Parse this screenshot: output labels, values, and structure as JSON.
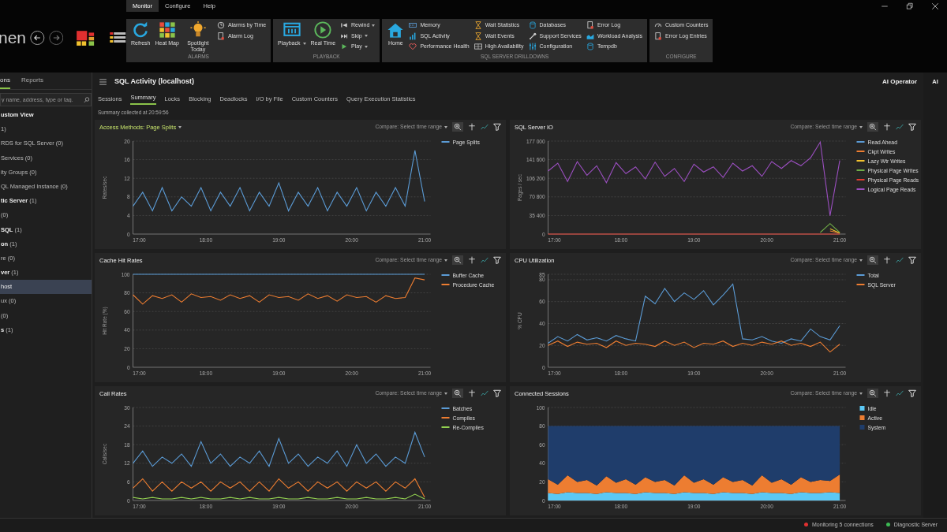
{
  "brand": "nen",
  "menu_tabs": [
    {
      "label": "Monitor",
      "selected": true
    },
    {
      "label": "Configure",
      "selected": false
    },
    {
      "label": "Help",
      "selected": false
    }
  ],
  "ribbon": [
    {
      "caption": "ALARMS",
      "items": [
        {
          "label": "Refresh",
          "kind": "large"
        },
        {
          "label": "Heat Map",
          "kind": "large"
        },
        {
          "label": "Spotlight Today",
          "kind": "large"
        },
        {
          "label": "Alarms by Time",
          "kind": "small"
        },
        {
          "label": "Alarm Log",
          "kind": "small"
        }
      ]
    },
    {
      "caption": "PLAYBACK",
      "items": [
        {
          "label": "Playback",
          "kind": "large",
          "dropdown": true
        },
        {
          "label": "Real Time",
          "kind": "large"
        },
        {
          "label": "Rewind",
          "kind": "small",
          "dropdown": true
        },
        {
          "label": "Skip",
          "kind": "small",
          "dropdown": true
        },
        {
          "label": "Play",
          "kind": "small",
          "dropdown": true
        }
      ]
    },
    {
      "caption": "SQL SERVER DRILLDOWNS",
      "items": [
        {
          "label": "Home",
          "kind": "large"
        },
        {
          "label": "Memory",
          "kind": "small"
        },
        {
          "label": "SQL Activity",
          "kind": "small"
        },
        {
          "label": "Performance Health",
          "kind": "small"
        },
        {
          "label": "Wait Statistics",
          "kind": "small"
        },
        {
          "label": "Wait Events",
          "kind": "small"
        },
        {
          "label": "High Availability",
          "kind": "small"
        },
        {
          "label": "Databases",
          "kind": "small"
        },
        {
          "label": "Support Services",
          "kind": "small"
        },
        {
          "label": "Configuration",
          "kind": "small"
        },
        {
          "label": "Error Log",
          "kind": "small"
        },
        {
          "label": "Workload Analysis",
          "kind": "small"
        },
        {
          "label": "Tempdb",
          "kind": "small"
        }
      ]
    },
    {
      "caption": "CONFIGURE",
      "items": [
        {
          "label": "Custom Counters",
          "kind": "small"
        },
        {
          "label": "Error Log Entries",
          "kind": "small"
        }
      ]
    }
  ],
  "sidebar": {
    "tabs": [
      {
        "label": "ons",
        "selected": true
      },
      {
        "label": "Reports",
        "selected": false
      }
    ],
    "search": {
      "placeholder": "y name, address, type or tag."
    },
    "items": [
      {
        "text": "**ustom View**",
        "selected": false
      },
      {
        "text": "1)",
        "selected": false
      },
      {
        "text": "RDS for SQL Server (0)",
        "selected": false
      },
      {
        "text": "Services (0)",
        "selected": false
      },
      {
        "text": "ity Groups (0)",
        "selected": false
      },
      {
        "text": "QL Managed Instance (0)",
        "selected": false
      },
      {
        "text": "**tic Server** (1)",
        "selected": false
      },
      {
        "text": "(0)",
        "selected": false
      },
      {
        "text": "**SQL** (1)",
        "selected": false
      },
      {
        "text": "**on** (1)",
        "selected": false
      },
      {
        "text": "re (0)",
        "selected": false
      },
      {
        "text": "**ver** (1)",
        "selected": false
      },
      {
        "text": "host",
        "selected": true
      },
      {
        "text": "ux (0)",
        "selected": false
      },
      {
        "text": "(0)",
        "selected": false
      },
      {
        "text": "**s** (1)",
        "selected": false
      }
    ]
  },
  "main": {
    "title": "SQL Activity (localhost)",
    "ai_operator": "AI Operator",
    "tabs": [
      {
        "label": "Sessions",
        "selected": false
      },
      {
        "label": "Summary",
        "selected": true
      },
      {
        "label": "Locks",
        "selected": false
      },
      {
        "label": "Blocking",
        "selected": false
      },
      {
        "label": "Deadlocks",
        "selected": false
      },
      {
        "label": "I/O by File",
        "selected": false
      },
      {
        "label": "Custom Counters",
        "selected": false
      },
      {
        "label": "Query Execution Statistics",
        "selected": false
      }
    ],
    "collected": "Summary collected at 20:59:56",
    "panels": [
      {
        "title": "Access Methods: Page Splits",
        "title_dropdown": true,
        "compare": "Compare: Select time range",
        "chart_data": {
          "type": "line",
          "grid": true,
          "legend": "right",
          "ylabel": "Rates/sec",
          "x": [
            17,
            17.133,
            17.267,
            17.4,
            17.533,
            17.667,
            17.8,
            17.933,
            18.067,
            18.2,
            18.333,
            18.467,
            18.6,
            18.733,
            18.867,
            19,
            19.133,
            19.267,
            19.4,
            19.533,
            19.667,
            19.8,
            19.933,
            20.067,
            20.2,
            20.333,
            20.467,
            20.6,
            20.733,
            20.867,
            21
          ],
          "xlim": [
            17,
            21.08
          ],
          "ylim": [
            0,
            20
          ],
          "xticks": [
            {
              "value": 17,
              "label": "17:00"
            },
            {
              "value": 18,
              "label": "18:00"
            },
            {
              "value": 19,
              "label": "19:00"
            },
            {
              "value": 20,
              "label": "20:00"
            },
            {
              "value": 21,
              "label": "21:00"
            }
          ],
          "yticks": [
            0,
            4,
            8,
            12,
            16,
            20
          ],
          "series": [
            {
              "name": "Page Splits",
              "color": "#5b9bd5",
              "values": [
                6,
                9,
                5,
                10,
                5,
                8,
                6,
                10,
                5,
                9,
                6,
                10,
                5,
                9,
                6,
                11,
                5,
                9,
                6,
                10,
                5,
                9,
                6,
                10,
                5,
                9,
                6,
                10,
                6,
                18,
                7
              ]
            }
          ]
        }
      },
      {
        "title": "SQL Server IO",
        "title_dropdown": false,
        "compare": "Compare: Select time range",
        "chart_data": {
          "type": "line",
          "grid": true,
          "legend": "right",
          "ylabel": "Pages / sec",
          "x": [
            17,
            17.133,
            17.267,
            17.4,
            17.533,
            17.667,
            17.8,
            17.933,
            18.067,
            18.2,
            18.333,
            18.467,
            18.6,
            18.733,
            18.867,
            19,
            19.133,
            19.267,
            19.4,
            19.533,
            19.667,
            19.8,
            19.933,
            20.067,
            20.2,
            20.333,
            20.467,
            20.6,
            20.733,
            20.867,
            21
          ],
          "xlim": [
            17,
            21.08
          ],
          "ylim": [
            0,
            177000
          ],
          "xticks": [
            {
              "value": 17,
              "label": "17:00"
            },
            {
              "value": 18,
              "label": "18:00"
            },
            {
              "value": 19,
              "label": "19:00"
            },
            {
              "value": 20,
              "label": "20:00"
            },
            {
              "value": 21,
              "label": "21:00"
            }
          ],
          "yticks": [
            {
              "value": 0,
              "label": "0"
            },
            {
              "value": 35400,
              "label": "35 400"
            },
            {
              "value": 70800,
              "label": "70 800"
            },
            {
              "value": 106200,
              "label": "106 200"
            },
            {
              "value": 141600,
              "label": "141 600"
            },
            {
              "value": 177000,
              "label": "177 000"
            }
          ],
          "series": [
            {
              "name": "Read Ahead",
              "color": "#5b9bd5",
              "values": [
                null,
                null,
                null,
                null,
                null,
                null,
                null,
                null,
                null,
                null,
                null,
                null,
                null,
                null,
                null,
                null,
                null,
                null,
                null,
                null,
                null,
                null,
                null,
                null,
                null,
                null,
                null,
                null,
                null,
                null,
                null
              ]
            },
            {
              "name": "Ckpt Writes",
              "color": "#ed7d31",
              "values": [
                null,
                null,
                null,
                null,
                null,
                null,
                null,
                null,
                null,
                null,
                null,
                null,
                null,
                null,
                null,
                null,
                null,
                null,
                null,
                null,
                null,
                null,
                null,
                null,
                null,
                null,
                null,
                null,
                null,
                6000,
                2000
              ]
            },
            {
              "name": "Lazy Wtr Writes",
              "color": "#f2c12e",
              "values": [
                null,
                null,
                null,
                null,
                null,
                null,
                null,
                null,
                null,
                null,
                null,
                null,
                null,
                null,
                null,
                null,
                null,
                null,
                null,
                null,
                null,
                null,
                null,
                null,
                null,
                null,
                null,
                null,
                null,
                10000,
                2000
              ]
            },
            {
              "name": "Physical Page Writes",
              "color": "#70ad47",
              "values": [
                null,
                null,
                null,
                null,
                null,
                null,
                null,
                null,
                null,
                null,
                null,
                null,
                null,
                null,
                null,
                null,
                null,
                null,
                null,
                null,
                null,
                null,
                null,
                null,
                null,
                null,
                null,
                null,
                3000,
                20000,
                3000
              ]
            },
            {
              "name": "Physical Page Reads",
              "color": "#e03c31",
              "values": [
                0,
                0,
                0,
                0,
                0,
                0,
                0,
                0,
                0,
                0,
                0,
                0,
                0,
                0,
                0,
                0,
                0,
                0,
                0,
                0,
                0,
                0,
                0,
                0,
                0,
                0,
                0,
                0,
                0,
                0,
                0
              ]
            },
            {
              "name": "Logical Page Reads",
              "color": "#9b4fc0",
              "values": [
                120000,
                135000,
                100000,
                138000,
                112000,
                130000,
                98000,
                136000,
                115000,
                128000,
                105000,
                137000,
                110000,
                125000,
                100000,
                133000,
                118000,
                128000,
                108000,
                135000,
                120000,
                130000,
                110000,
                138000,
                125000,
                140000,
                130000,
                145000,
                175000,
                35000,
                140000
              ]
            }
          ]
        }
      },
      {
        "title": "Cache Hit Rates",
        "title_dropdown": false,
        "compare": "Compare: Select time range",
        "chart_data": {
          "type": "line",
          "grid": true,
          "legend": "right",
          "ylabel": "Hit Rate (%)",
          "x": [
            17,
            17.133,
            17.267,
            17.4,
            17.533,
            17.667,
            17.8,
            17.933,
            18.067,
            18.2,
            18.333,
            18.467,
            18.6,
            18.733,
            18.867,
            19,
            19.133,
            19.267,
            19.4,
            19.533,
            19.667,
            19.8,
            19.933,
            20.067,
            20.2,
            20.333,
            20.467,
            20.6,
            20.733,
            20.867,
            21
          ],
          "xlim": [
            17,
            21.08
          ],
          "ylim": [
            0,
            100
          ],
          "xticks": [
            {
              "value": 17,
              "label": "17:00"
            },
            {
              "value": 18,
              "label": "18:00"
            },
            {
              "value": 19,
              "label": "19:00"
            },
            {
              "value": 20,
              "label": "20:00"
            },
            {
              "value": 21,
              "label": "21:00"
            }
          ],
          "yticks": [
            0,
            20,
            40,
            60,
            80,
            100
          ],
          "series": [
            {
              "name": "Buffer Cache",
              "color": "#5b9bd5",
              "values": [
                100,
                100,
                100,
                100,
                100,
                100,
                100,
                100,
                100,
                100,
                100,
                100,
                100,
                100,
                100,
                100,
                100,
                100,
                100,
                100,
                100,
                100,
                100,
                100,
                100,
                100,
                100,
                100,
                100,
                100,
                100
              ]
            },
            {
              "name": "Procedure Cache",
              "color": "#ed7d31",
              "values": [
                78,
                68,
                77,
                74,
                78,
                70,
                79,
                75,
                76,
                72,
                78,
                74,
                77,
                70,
                78,
                75,
                76,
                72,
                79,
                74,
                77,
                71,
                78,
                75,
                76,
                70,
                77,
                74,
                75,
                96,
                94
              ]
            }
          ]
        }
      },
      {
        "title": "CPU Utilization",
        "title_dropdown": false,
        "compare": "Compare: Select time range",
        "chart_data": {
          "type": "line",
          "grid": true,
          "legend": "right",
          "ylabel": "% CPU",
          "x": [
            17,
            17.133,
            17.267,
            17.4,
            17.533,
            17.667,
            17.8,
            17.933,
            18.067,
            18.2,
            18.333,
            18.467,
            18.6,
            18.733,
            18.867,
            19,
            19.133,
            19.267,
            19.4,
            19.533,
            19.667,
            19.8,
            19.933,
            20.067,
            20.2,
            20.333,
            20.467,
            20.6,
            20.733,
            20.867,
            21
          ],
          "xlim": [
            17,
            21.08
          ],
          "ylim": [
            0,
            85
          ],
          "xticks": [
            {
              "value": 17,
              "label": "17:00"
            },
            {
              "value": 18,
              "label": "18:00"
            },
            {
              "value": 19,
              "label": "19:00"
            },
            {
              "value": 20,
              "label": "20:00"
            },
            {
              "value": 21,
              "label": "21:00"
            }
          ],
          "yticks": [
            0,
            20,
            40,
            60,
            80,
            85
          ],
          "series": [
            {
              "name": "Total",
              "color": "#5b9bd5",
              "values": [
                22,
                28,
                24,
                30,
                25,
                27,
                24,
                29,
                26,
                24,
                65,
                58,
                72,
                60,
                68,
                62,
                70,
                57,
                66,
                76,
                26,
                25,
                28,
                24,
                22,
                26,
                24,
                35,
                28,
                25,
                38
              ]
            },
            {
              "name": "SQL Server",
              "color": "#ed7d31",
              "values": [
                20,
                24,
                19,
                23,
                21,
                22,
                18,
                24,
                20,
                22,
                21,
                19,
                24,
                20,
                23,
                18,
                22,
                21,
                24,
                19,
                22,
                20,
                23,
                21,
                24,
                20,
                22,
                19,
                23,
                14,
                21
              ]
            }
          ]
        }
      },
      {
        "title": "Call Rates",
        "title_dropdown": false,
        "compare": "Compare: Select time range",
        "chart_data": {
          "type": "line",
          "grid": true,
          "legend": "right",
          "ylabel": "Calls/sec",
          "x": [
            17,
            17.133,
            17.267,
            17.4,
            17.533,
            17.667,
            17.8,
            17.933,
            18.067,
            18.2,
            18.333,
            18.467,
            18.6,
            18.733,
            18.867,
            19,
            19.133,
            19.267,
            19.4,
            19.533,
            19.667,
            19.8,
            19.933,
            20.067,
            20.2,
            20.333,
            20.467,
            20.6,
            20.733,
            20.867,
            21
          ],
          "xlim": [
            17,
            21.08
          ],
          "ylim": [
            0,
            30
          ],
          "xticks": [
            {
              "value": 17,
              "label": "17:00"
            },
            {
              "value": 18,
              "label": "18:00"
            },
            {
              "value": 19,
              "label": "19:00"
            },
            {
              "value": 20,
              "label": "20:00"
            },
            {
              "value": 21,
              "label": "21:00"
            }
          ],
          "yticks": [
            0,
            6,
            12,
            18,
            24,
            30
          ],
          "series": [
            {
              "name": "Batches",
              "color": "#5b9bd5",
              "values": [
                12,
                16,
                11,
                14,
                12,
                15,
                11,
                19,
                12,
                15,
                11,
                14,
                12,
                16,
                11,
                20,
                12,
                15,
                11,
                14,
                12,
                16,
                11,
                18,
                12,
                15,
                11,
                14,
                12,
                22,
                14
              ]
            },
            {
              "name": "Compiles",
              "color": "#ed7d31",
              "values": [
                4,
                7,
                3,
                6,
                3,
                6,
                4,
                6,
                3,
                6,
                4,
                6,
                3,
                6,
                3,
                7,
                4,
                6,
                3,
                6,
                4,
                6,
                3,
                6,
                4,
                6,
                3,
                6,
                4,
                7,
                1
              ]
            },
            {
              "name": "Re-Compiles",
              "color": "#92d050",
              "values": [
                1,
                0.5,
                1,
                0.5,
                0.5,
                1,
                0.5,
                1,
                0.5,
                0.5,
                1,
                0.5,
                1,
                0.5,
                0.5,
                1,
                0.5,
                0.5,
                1,
                0.5,
                0.5,
                1,
                0.5,
                0.5,
                1,
                0.5,
                0.5,
                1,
                0.5,
                2,
                0.5
              ]
            }
          ]
        }
      },
      {
        "title": "Connected Sessions",
        "title_dropdown": false,
        "compare": "Compare: Select time range",
        "chart_data": {
          "type": "area",
          "stacked": true,
          "grid": true,
          "legend": "right",
          "x": [
            17,
            17.133,
            17.267,
            17.4,
            17.533,
            17.667,
            17.8,
            17.933,
            18.067,
            18.2,
            18.333,
            18.467,
            18.6,
            18.733,
            18.867,
            19,
            19.133,
            19.267,
            19.4,
            19.533,
            19.667,
            19.8,
            19.933,
            20.067,
            20.2,
            20.333,
            20.467,
            20.6,
            20.733,
            20.867,
            21
          ],
          "xlim": [
            17,
            21.08
          ],
          "ylim": [
            0,
            100
          ],
          "xticks": [
            {
              "value": 17,
              "label": "17:00"
            },
            {
              "value": 18,
              "label": "18:00"
            },
            {
              "value": 19,
              "label": "19:00"
            },
            {
              "value": 20,
              "label": "20:00"
            },
            {
              "value": 21,
              "label": "21:00"
            }
          ],
          "yticks": [
            0,
            20,
            40,
            60,
            80,
            100
          ],
          "series": [
            {
              "name": "Idle",
              "color": "#5bc8f5",
              "values": [
                8,
                7,
                9,
                8,
                8,
                7,
                9,
                8,
                8,
                7,
                9,
                8,
                8,
                7,
                9,
                8,
                8,
                7,
                9,
                8,
                8,
                7,
                9,
                8,
                8,
                7,
                9,
                8,
                8,
                9,
                8
              ]
            },
            {
              "name": "Active",
              "color": "#ed7d31",
              "values": [
                15,
                10,
                18,
                12,
                14,
                9,
                17,
                11,
                15,
                10,
                16,
                12,
                14,
                9,
                18,
                11,
                15,
                10,
                16,
                12,
                14,
                9,
                18,
                11,
                15,
                10,
                16,
                12,
                14,
                12,
                20
              ]
            },
            {
              "name": "System",
              "color": "#1f3d6b",
              "values": [
                57,
                63,
                53,
                60,
                58,
                64,
                54,
                61,
                57,
                63,
                55,
                60,
                58,
                64,
                53,
                61,
                57,
                63,
                55,
                60,
                58,
                64,
                53,
                61,
                57,
                63,
                55,
                60,
                58,
                59,
                52
              ]
            }
          ]
        }
      }
    ]
  },
  "ai_strip": "AI",
  "status": [
    {
      "text": "Monitoring 5 connections",
      "color": "#e03030"
    },
    {
      "text": "Diagnostic Server",
      "color": "#3cba54"
    }
  ]
}
